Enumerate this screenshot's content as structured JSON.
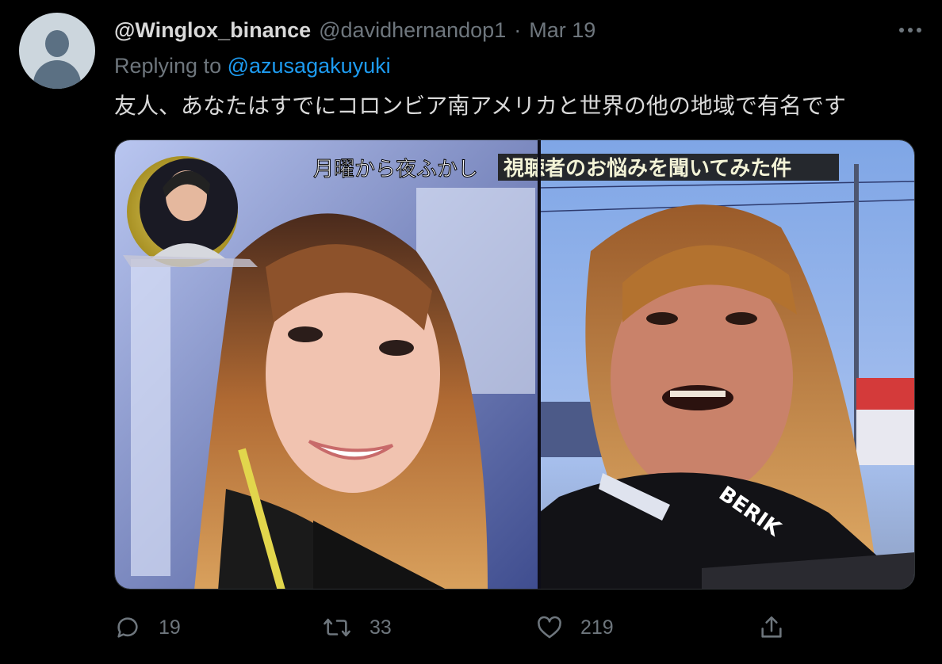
{
  "tweet": {
    "display_name": "@Winglox_binance",
    "handle": "@davidhernandop1",
    "separator": "·",
    "date": "Mar 19",
    "replying_prefix": "Replying to",
    "replying_to": "@azusagakuyuki",
    "text": "友人、あなたはすでにコロンビア南アメリカと世界の他の地域で有名です"
  },
  "media": {
    "show_title": "月曜から夜ふかし",
    "caption": "視聴者のお悩みを聞いてみた件",
    "jacket_brand": "BERIK"
  },
  "actions": {
    "reply_count": "19",
    "retweet_count": "33",
    "like_count": "219"
  },
  "icons": {
    "more": "more-icon",
    "reply": "reply-icon",
    "retweet": "retweet-icon",
    "like": "like-icon",
    "share": "share-icon"
  },
  "colors": {
    "background": "#000000",
    "text": "#d9d9d9",
    "secondary": "#6e767d",
    "link": "#1d9bf0"
  }
}
